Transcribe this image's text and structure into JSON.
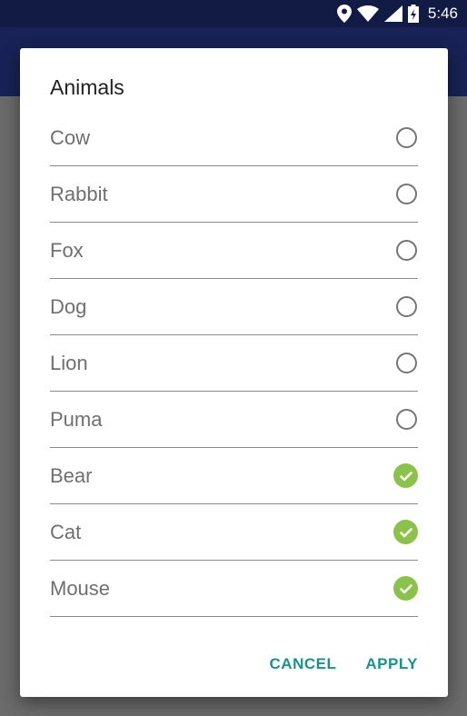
{
  "status_bar": {
    "time": "5:46",
    "icons": [
      "location-icon",
      "wifi-icon",
      "signal-icon",
      "battery-icon"
    ]
  },
  "dialog": {
    "title": "Animals",
    "options": [
      {
        "label": "Cow",
        "selected": false
      },
      {
        "label": "Rabbit",
        "selected": false
      },
      {
        "label": "Fox",
        "selected": false
      },
      {
        "label": "Dog",
        "selected": false
      },
      {
        "label": "Lion",
        "selected": false
      },
      {
        "label": "Puma",
        "selected": false
      },
      {
        "label": "Bear",
        "selected": true
      },
      {
        "label": "Cat",
        "selected": true
      },
      {
        "label": "Mouse",
        "selected": true
      }
    ],
    "cancel_label": "CANCEL",
    "apply_label": "APPLY"
  },
  "colors": {
    "status_bar": "#121b44",
    "app_bar": "#182256",
    "accent": "#179487",
    "selected": "#8bc34a"
  }
}
